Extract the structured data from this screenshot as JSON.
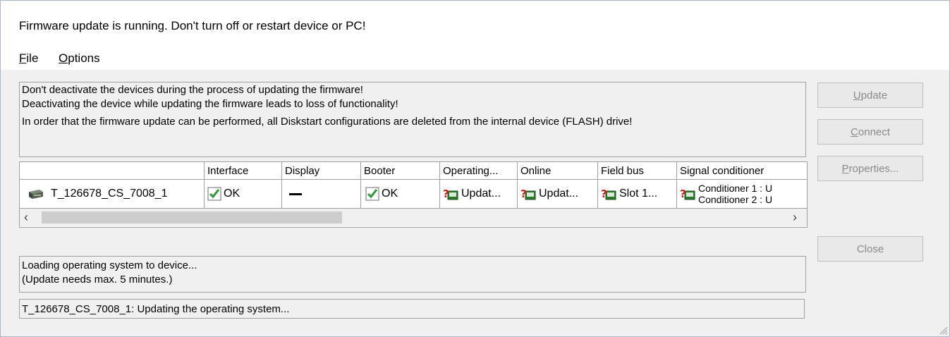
{
  "window": {
    "title": "Firmware update is running. Don't turn off or restart device or PC!"
  },
  "menu": [
    {
      "mnemonic": "F",
      "rest": "ile"
    },
    {
      "mnemonic": "O",
      "rest": "ptions"
    }
  ],
  "message": {
    "line1": "Don't deactivate the devices during the process of updating the firmware!",
    "line2": "Deactivating the device while updating the firmware leads to loss of functionality!",
    "line3": "In order that the firmware update can be performed, all Diskstart configurations are deleted from the internal device (FLASH) drive!"
  },
  "grid": {
    "columns": [
      "",
      "Interface",
      "Display",
      "Booter",
      "Operating...",
      "Online",
      "Field bus",
      "Signal conditioner"
    ],
    "row": {
      "device": "T_126678_CS_7008_1",
      "interface": "OK",
      "display": "",
      "booter": "OK",
      "operating": "Updat...",
      "online": "Updat...",
      "fieldbus": "Slot 1...",
      "signal_line1": "Conditioner 1 :  U",
      "signal_line2": "Conditioner 2 :  U"
    }
  },
  "status": {
    "line1": "Loading operating system to device...",
    "line2": "(Update needs max. 5 minutes.)",
    "detail": "T_126678_CS_7008_1: Updating the operating system..."
  },
  "buttons": {
    "update": {
      "mnemonic": "U",
      "rest": "pdate"
    },
    "connect": {
      "mnemonic": "C",
      "rest": "onnect"
    },
    "properties": {
      "mnemonic": "P",
      "rest": "roperties..."
    },
    "close": "Close"
  },
  "colors": {
    "check": "#2e9b2e",
    "disabled_text": "#8a8a8a"
  }
}
